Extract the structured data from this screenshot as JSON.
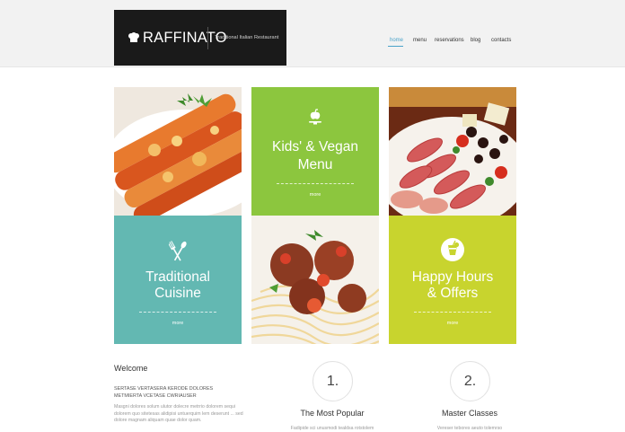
{
  "brand": {
    "name": "RAFFINATO",
    "tagline": "Traditional Italian Restaurant"
  },
  "nav": [
    {
      "label": "home",
      "active": true
    },
    {
      "label": "menu",
      "active": false
    },
    {
      "label": "reservations",
      "active": false
    },
    {
      "label": "blog",
      "active": false
    },
    {
      "label": "contacts",
      "active": false
    }
  ],
  "tiles": {
    "kids": {
      "title_line1": "Kids' & Vegan",
      "title_line2": "Menu",
      "more": "more",
      "icon": "apple-on-plate-icon",
      "color": "#8cc63e"
    },
    "traditional": {
      "title_line1": "Traditional",
      "title_line2": "Cuisine",
      "more": "more",
      "icon": "fork-and-spoon-icon",
      "color": "#63b8b2"
    },
    "happy": {
      "title_line1": "Happy Hours",
      "title_line2": "& Offers",
      "more": "more",
      "icon": "cocktail-glass-icon",
      "color": "#c8d42e"
    }
  },
  "welcome": {
    "title": "Welcome",
    "subtitle": "SERTASE VERTASERA KERODE DOLORES METMIERTA VCETASE CWRIAUSER",
    "body": "Masgni dolores solum ulutor dolecre metrrio dolorem sequi dolorem quo sitetesas alidipisi untuerquim lem deserunt ... sed dolore magnam aliquam quae dolor quam."
  },
  "features": [
    {
      "number": "1.",
      "title": "The Most Popular",
      "text": "Fadipide sci unusmodi tealdsa rotstolem"
    },
    {
      "number": "2.",
      "title": "Master Classes",
      "text": "Vereser tebores aeuto tolemrso"
    }
  ]
}
